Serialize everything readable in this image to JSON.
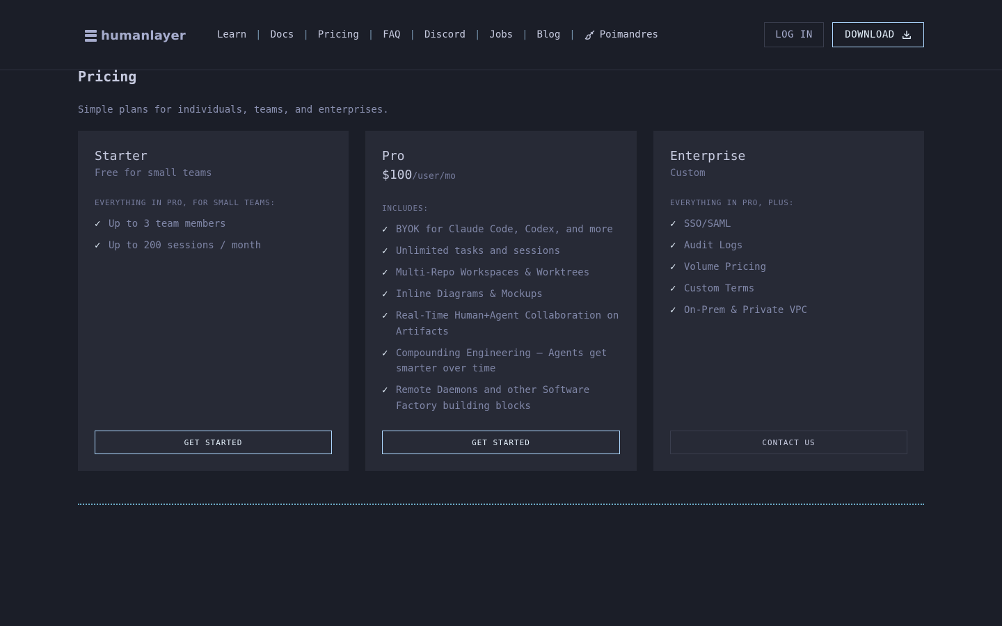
{
  "header": {
    "logo_text": "humanlayer",
    "nav": [
      {
        "label": "Learn"
      },
      {
        "label": "Docs"
      },
      {
        "label": "Pricing"
      },
      {
        "label": "FAQ"
      },
      {
        "label": "Discord"
      },
      {
        "label": "Jobs"
      },
      {
        "label": "Blog"
      },
      {
        "label": "Poimandres",
        "icon": "paintbrush-icon"
      }
    ],
    "separator": "|",
    "login_label": "LOG IN",
    "download_label": "DOWNLOAD",
    "download_icon": "download-icon"
  },
  "page": {
    "title": "Pricing",
    "subtitle": "Simple plans for individuals, teams, and enterprises."
  },
  "plans": [
    {
      "name": "Starter",
      "subtitle": "Free for small teams",
      "includes_label": "EVERYTHING IN PRO, FOR SMALL TEAMS:",
      "features": [
        "Up to 3 team members",
        "Up to 200 sessions / month"
      ],
      "button_label": "GET STARTED"
    },
    {
      "name": "Pro",
      "price": "$100",
      "price_unit": "/user/mo",
      "includes_label": "INCLUDES:",
      "features": [
        "BYOK for Claude Code, Codex, and more",
        "Unlimited tasks and sessions",
        "Multi-Repo Workspaces & Worktrees",
        "Inline Diagrams & Mockups",
        "Real-Time Human+Agent Collaboration on Artifacts",
        "Compounding Engineering — Agents get smarter over time",
        "Remote Daemons and other Software Factory building blocks"
      ],
      "button_label": "GET STARTED"
    },
    {
      "name": "Enterprise",
      "subtitle": "Custom",
      "includes_label": "EVERYTHING IN PRO, PLUS:",
      "features": [
        "SSO/SAML",
        "Audit Logs",
        "Volume Pricing",
        "Custom Terms",
        "On-Prem & Private VPC"
      ],
      "button_label": "CONTACT US"
    }
  ],
  "check_glyph": "✓",
  "colors": {
    "background": "#1b1e28",
    "card": "#272a36",
    "accent": "#add7ff",
    "divider": "#89ddff"
  }
}
